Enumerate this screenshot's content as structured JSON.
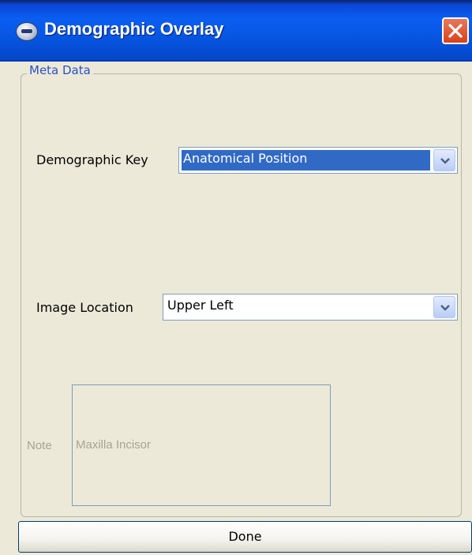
{
  "window": {
    "title": "Demographic Overlay",
    "accent": "#0758e6",
    "close_color": "#d7421a"
  },
  "group": {
    "legend": "Meta Data"
  },
  "demographic_key": {
    "label": "Demographic Key",
    "value": "Anatomical Position",
    "selected_color": "#316ac5"
  },
  "image_location": {
    "label": "Image Location",
    "value": "Upper Left"
  },
  "note": {
    "label": "Note",
    "text": "Maxilla Incisor"
  },
  "footer": {
    "done_label": "Done"
  },
  "icons": {
    "app": "app-icon",
    "close": "close-icon",
    "dropdown": "chevron-down-icon"
  }
}
